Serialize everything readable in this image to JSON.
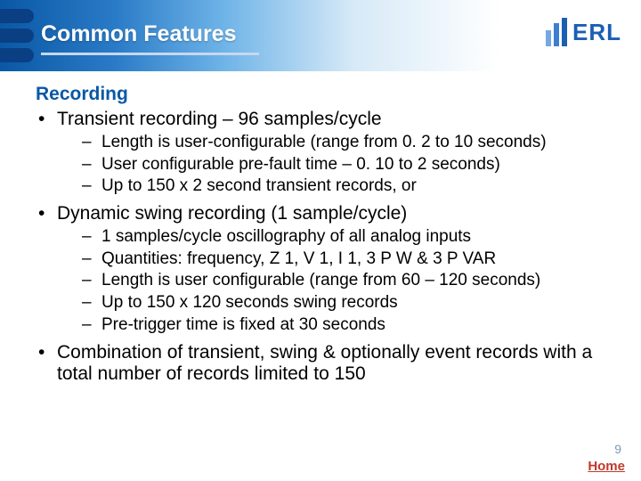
{
  "header": {
    "title": "Common Features",
    "logo_text": "ERL"
  },
  "section_heading": "Recording",
  "bullets": {
    "b1": {
      "text": "Transient recording – 96 samples/cycle",
      "subs": {
        "s1": "Length is user-configurable (range from 0. 2 to 10 seconds)",
        "s2": "User configurable pre-fault time – 0. 10 to 2 seconds)",
        "s3": "Up to 150 x 2 second transient records, or"
      }
    },
    "b2": {
      "text": "Dynamic swing recording (1 sample/cycle)",
      "subs": {
        "s1": "1 samples/cycle oscillography of all analog inputs",
        "s2": "Quantities: frequency, Z 1, V 1, I 1, 3 P W & 3 P VAR",
        "s3": "Length is user configurable (range from 60 – 120 seconds)",
        "s4": "Up to 150 x 120 seconds swing records",
        "s5": "Pre-trigger time is fixed at 30 seconds"
      }
    },
    "b3": {
      "text": "Combination of transient, swing & optionally event records with a total number of records limited to 150"
    }
  },
  "footer": {
    "page_number": "9",
    "home_label": "Home"
  }
}
